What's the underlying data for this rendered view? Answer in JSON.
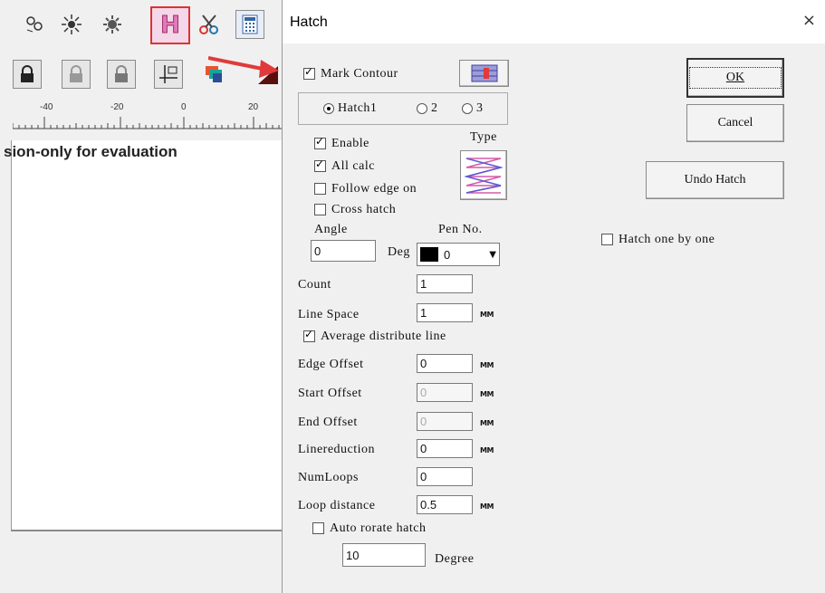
{
  "app": {
    "ruler_ticks": [
      "-40",
      "-20",
      "0",
      "20"
    ],
    "eval_text": "sion-only for evaluation"
  },
  "dialog": {
    "title": "Hatch",
    "close_glyph": "×",
    "mark_contour_label": "Mark Contour",
    "hatch_radios": [
      {
        "label": "Hatch1",
        "selected": true
      },
      {
        "label": "2",
        "selected": false
      },
      {
        "label": "3",
        "selected": false
      }
    ],
    "enable_label": "Enable",
    "all_calc_label": "All calc",
    "follow_edge_label": "Follow edge on",
    "cross_hatch_label": "Cross hatch",
    "type_label": "Type",
    "angle_label": "Angle",
    "angle_value": "0",
    "deg_label": "Deg",
    "pen_no_label": "Pen No.",
    "pen_value": "0",
    "count_label": "Count",
    "count_value": "1",
    "line_space_label": "Line Space",
    "line_space_value": "1",
    "unit_label": "MM",
    "average_distribute_label": "Average distribute line",
    "edge_offset_label": "Edge Offset",
    "edge_offset_value": "0",
    "start_offset_label": "Start Offset",
    "start_offset_value": "0",
    "end_offset_label": "End Offset",
    "end_offset_value": "0",
    "linereduction_label": "Linereduction",
    "linereduction_value": "0",
    "numloops_label": "NumLoops",
    "numloops_value": "0",
    "loop_distance_label": "Loop distance",
    "loop_distance_value": "0.5",
    "auto_rotate_label": "Auto rorate hatch",
    "rotate_value": "10",
    "degree_label": "Degree",
    "ok_label": "OK",
    "cancel_label": "Cancel",
    "undo_hatch_label": "Undo Hatch",
    "hatch_one_by_one_label": "Hatch one by one"
  },
  "colors": {
    "accent_red": "#e03a3a",
    "pink_button": "#e07ab8",
    "pen_color": "#000000"
  }
}
